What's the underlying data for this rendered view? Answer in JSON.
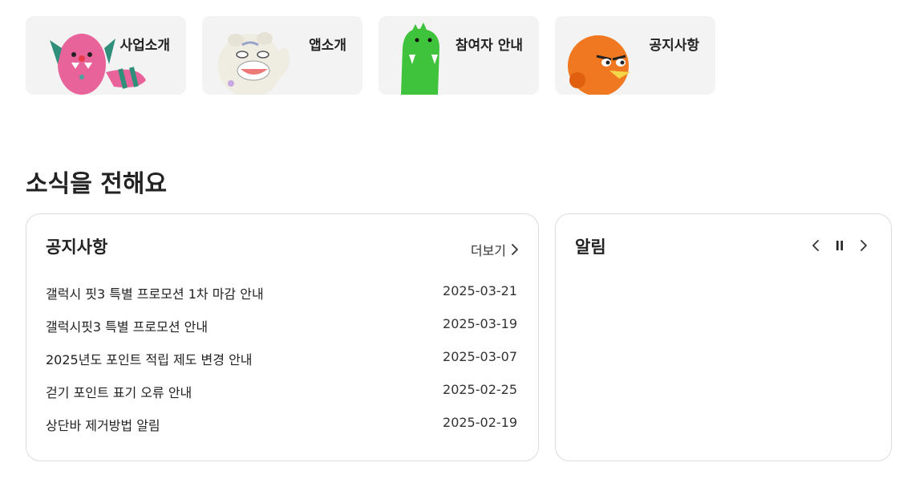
{
  "quick_menu": [
    {
      "label": "사업소개",
      "icon": "pink-monster-icon"
    },
    {
      "label": "앱소개",
      "icon": "white-tiger-icon"
    },
    {
      "label": "참여자 안내",
      "icon": "green-dino-icon"
    },
    {
      "label": "공지사항",
      "icon": "orange-bird-icon"
    }
  ],
  "news": {
    "title": "소식을 전해요"
  },
  "notice": {
    "title": "공지사항",
    "more_label": "더보기",
    "items": [
      {
        "title": "갤럭시 핏3 특별 프로모션 1차 마감 안내",
        "date": "2025-03-21"
      },
      {
        "title": "갤럭시핏3 특별 프로모션 안내",
        "date": "2025-03-19"
      },
      {
        "title": "2025년도 포인트 적립 제도 변경 안내",
        "date": "2025-03-07"
      },
      {
        "title": "걷기 포인트 표기 오류 안내",
        "date": "2025-02-25"
      },
      {
        "title": "상단바 제거방법 알림",
        "date": "2025-02-19"
      }
    ]
  },
  "alert": {
    "title": "알림"
  },
  "colors": {
    "card_bg": "#f3f3f3",
    "border": "#dcdcdc",
    "text": "#222222"
  }
}
